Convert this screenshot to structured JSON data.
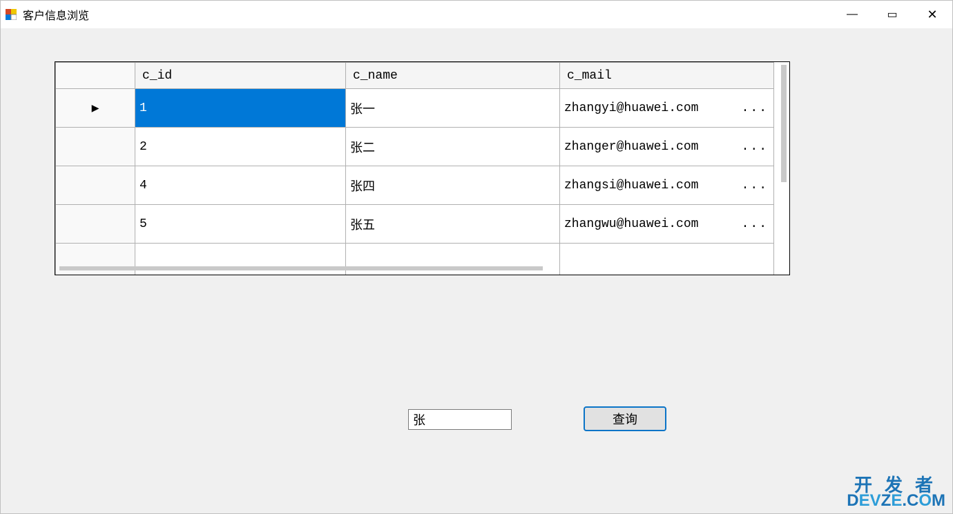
{
  "window": {
    "title": "客户信息浏览",
    "controls": {
      "min": "—",
      "max": "▭",
      "close": "✕"
    }
  },
  "grid": {
    "headers": {
      "c_id": "c_id",
      "c_name": "c_name",
      "c_mail": "c_mail"
    },
    "rows": [
      {
        "ptr": "▶",
        "c_id": "1",
        "c_name": "张一",
        "c_mail": "zhangyi@huawei.com",
        "ell": "...",
        "selected_col": "c_id"
      },
      {
        "ptr": "",
        "c_id": "2",
        "c_name": "张二",
        "c_mail": "zhanger@huawei.com",
        "ell": "..."
      },
      {
        "ptr": "",
        "c_id": "4",
        "c_name": "张四",
        "c_mail": "zhangsi@huawei.com",
        "ell": "..."
      },
      {
        "ptr": "",
        "c_id": "5",
        "c_name": "张五",
        "c_mail": "zhangwu@huawei.com",
        "ell": "..."
      }
    ]
  },
  "search": {
    "value": "张"
  },
  "buttons": {
    "query": "查询"
  },
  "watermark": {
    "l1": "开发者",
    "l2a": "D",
    "l2b": "EV",
    "l2c": "Z",
    "l2d": "E",
    "l2e": ".C",
    "l2f": "O",
    "l2g": "M"
  }
}
